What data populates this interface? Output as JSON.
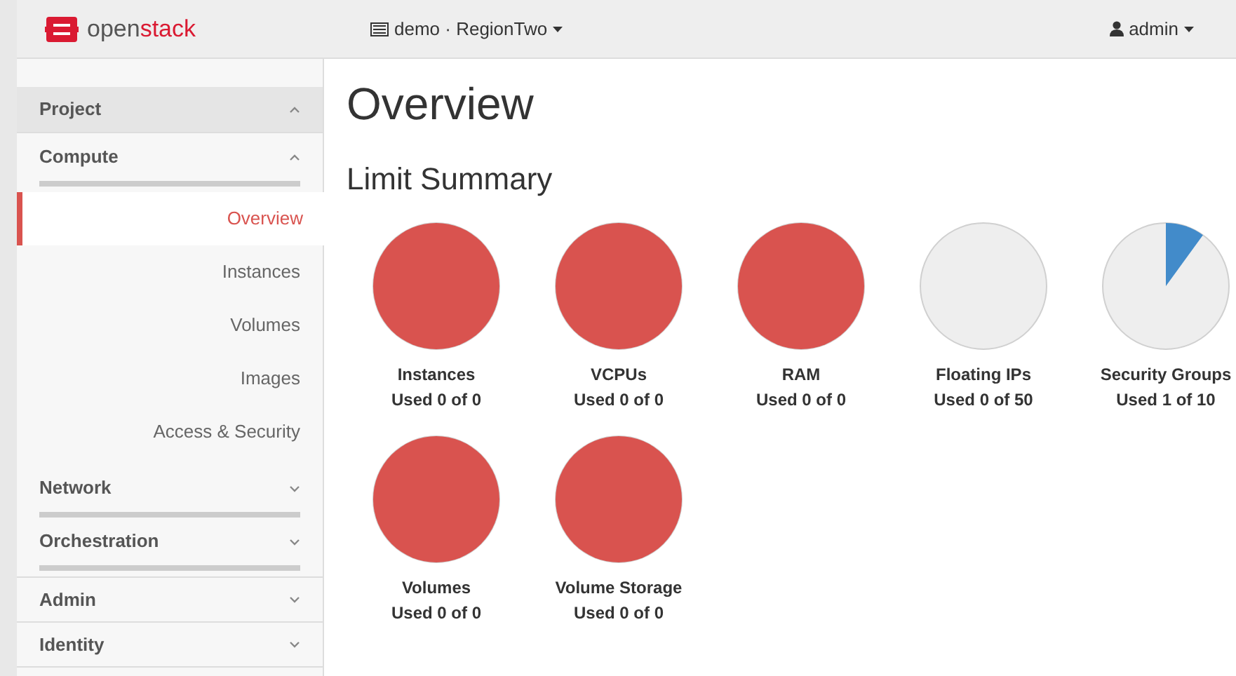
{
  "topbar": {
    "logo_parts": [
      "open",
      "stack"
    ],
    "project_menu": "demo · RegionTwo",
    "user_menu": "admin"
  },
  "sidebar": {
    "panels": [
      {
        "label": "Project",
        "expanded": true,
        "children": [
          {
            "label": "Compute",
            "expanded": true,
            "children": [
              {
                "label": "Overview",
                "selected": true
              },
              {
                "label": "Instances",
                "selected": false
              },
              {
                "label": "Volumes",
                "selected": false
              },
              {
                "label": "Images",
                "selected": false
              },
              {
                "label": "Access & Security",
                "selected": false
              }
            ]
          },
          {
            "label": "Network",
            "expanded": false
          },
          {
            "label": "Orchestration",
            "expanded": false
          }
        ]
      },
      {
        "label": "Admin",
        "expanded": false
      },
      {
        "label": "Identity",
        "expanded": false
      }
    ]
  },
  "page_title": "Overview",
  "section_title": "Limit Summary",
  "limits": [
    {
      "name": "Instances",
      "usage": "Used 0 of 0",
      "kind": "full",
      "color": "#d9534f"
    },
    {
      "name": "VCPUs",
      "usage": "Used 0 of 0",
      "kind": "full",
      "color": "#d9534f"
    },
    {
      "name": "RAM",
      "usage": "Used 0 of 0",
      "kind": "full",
      "color": "#d9534f"
    },
    {
      "name": "Floating IPs",
      "usage": "Used 0 of 50",
      "kind": "empty"
    },
    {
      "name": "Security Groups",
      "usage": "Used 1 of 10",
      "kind": "partial",
      "color": "#428bca"
    },
    {
      "name": "Volumes",
      "usage": "Used 0 of 0",
      "kind": "full",
      "color": "#d9534f"
    },
    {
      "name": "Volume Storage",
      "usage": "Used 0 of 0",
      "kind": "full",
      "color": "#d9534f"
    }
  ]
}
